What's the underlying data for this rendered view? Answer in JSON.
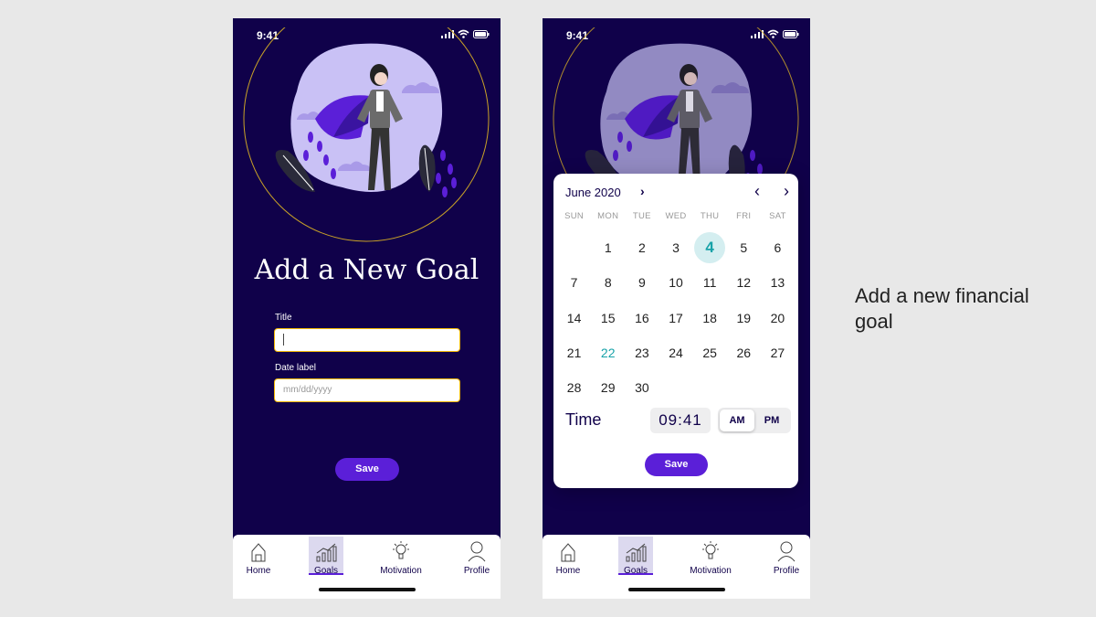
{
  "status_bar": {
    "time": "9:41"
  },
  "screen1": {
    "heading": "Add a New Goal",
    "title_label": "Title",
    "title_value": "",
    "date_label": "Date label",
    "date_placeholder": "mm/dd/yyyy",
    "save_label": "Save"
  },
  "screen2": {
    "calendar": {
      "month": "June 2020",
      "weekdays": [
        "SUN",
        "MON",
        "TUE",
        "WED",
        "THU",
        "FRI",
        "SAT"
      ],
      "days": [
        "",
        "1",
        "2",
        "3",
        "4",
        "5",
        "6",
        "7",
        "8",
        "9",
        "10",
        "11",
        "12",
        "13",
        "14",
        "15",
        "16",
        "17",
        "18",
        "19",
        "20",
        "21",
        "22",
        "23",
        "24",
        "25",
        "26",
        "27",
        "28",
        "29",
        "30"
      ],
      "selected_day": "4",
      "today": "22",
      "time_label": "Time",
      "time_value": "09:41",
      "am_label": "AM",
      "pm_label": "PM",
      "selected_period": "AM"
    },
    "save_label": "Save"
  },
  "nav": {
    "items": [
      {
        "label": "Home",
        "icon": "home-icon"
      },
      {
        "label": "Goals",
        "icon": "goals-chart-icon",
        "active": true
      },
      {
        "label": "Motivation",
        "icon": "lightbulb-icon"
      },
      {
        "label": "Profile",
        "icon": "profile-icon"
      }
    ]
  },
  "caption": "Add a new financial goal",
  "colors": {
    "background": "#10014a",
    "accent": "#5b1fd8",
    "input_border": "#f2b705",
    "selected_day": "#17a2a8"
  }
}
